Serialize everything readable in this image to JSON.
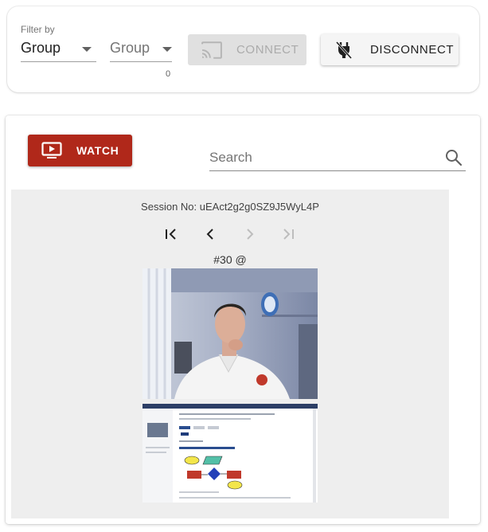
{
  "filter": {
    "label": "Filter by",
    "group_select_value": "Group",
    "group_select_2_placeholder": "Group",
    "counter": "0"
  },
  "toolbar": {
    "connect_label": "CONNECT",
    "connect_icon": "cast-icon",
    "disconnect_label": "DISCONNECT",
    "disconnect_icon": "power-off-icon"
  },
  "main": {
    "watch_label": "WATCH",
    "watch_icon": "tv-play-icon",
    "search_placeholder": "Search",
    "session_title": "Session No: uEAct2g2g0SZ9J5WyL4P",
    "frame_label": "#30 @"
  },
  "colors": {
    "watch_bg": "#b0281a",
    "panel_bg": "#eeeeee",
    "disabled_bg": "#e0e0e0"
  }
}
